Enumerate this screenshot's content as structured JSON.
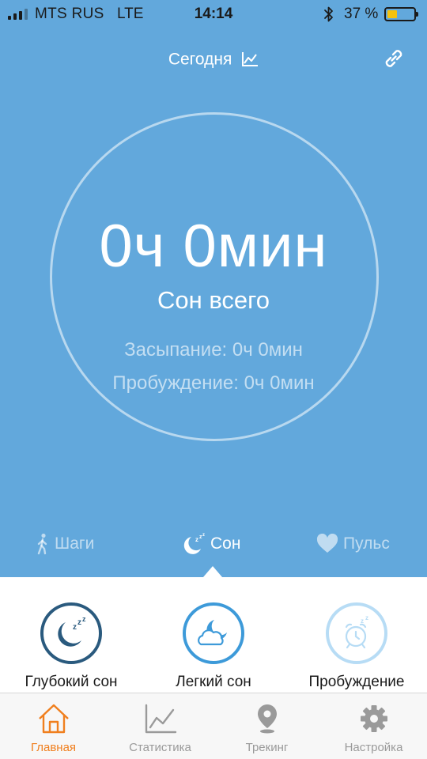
{
  "status_bar": {
    "carrier": "MTS RUS",
    "network": "LTE",
    "time": "14:14",
    "battery_percent": "37 %",
    "battery_level": 0.37,
    "battery_color": "#f4c20d"
  },
  "header": {
    "title": "Сегодня",
    "chart_icon": "chart-line-icon",
    "link_icon": "link-icon"
  },
  "summary": {
    "total_value": "0ч 0мин",
    "total_label": "Сон всего",
    "fall_asleep": "Засыпание: 0ч 0мин",
    "wake_up": "Пробуждение: 0ч 0мин"
  },
  "mode_tabs": [
    {
      "label": "Шаги",
      "icon": "walking-person-icon",
      "active": false
    },
    {
      "label": "Сон",
      "icon": "moon-sleep-icon",
      "active": true
    },
    {
      "label": "Пульс",
      "icon": "heart-icon",
      "active": false
    }
  ],
  "sleep_types": [
    {
      "label": "Глубокий сон",
      "icon": "deep-sleep-moon-icon",
      "color": "#2a5a7e"
    },
    {
      "label": "Легкий сон",
      "icon": "light-sleep-cloud-moon-icon",
      "color": "#3d9ad9"
    },
    {
      "label": "Пробуждение",
      "icon": "alarm-clock-icon",
      "color": "#b7dcf5"
    }
  ],
  "tab_bar": [
    {
      "label": "Главная",
      "icon": "home-icon",
      "active": true
    },
    {
      "label": "Статистика",
      "icon": "stats-chart-icon",
      "active": false
    },
    {
      "label": "Трекинг",
      "icon": "location-pin-icon",
      "active": false
    },
    {
      "label": "Настройка",
      "icon": "gear-icon",
      "active": false
    }
  ],
  "colors": {
    "header_bg": "#62a8dc",
    "accent": "#f07f1e",
    "inactive": "#9a9a9a"
  }
}
